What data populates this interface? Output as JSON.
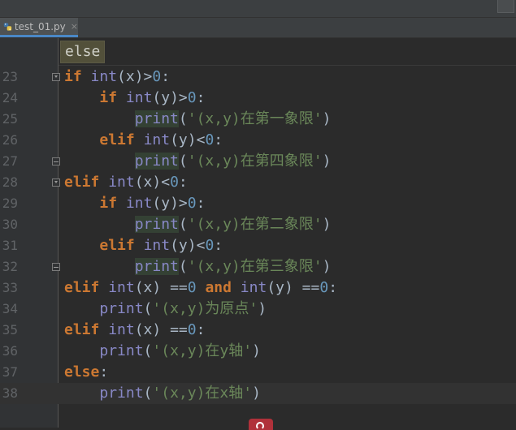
{
  "tab": {
    "filename": "test_01.py",
    "close_glyph": "×"
  },
  "tooltip": {
    "text": "else"
  },
  "lines": [
    {
      "num": "23",
      "tokens": [
        {
          "t": "if",
          "c": "kw"
        },
        {
          "t": " ",
          "c": "pl"
        },
        {
          "t": "int",
          "c": "bi"
        },
        {
          "t": "(x)>",
          "c": "pl"
        },
        {
          "t": "0",
          "c": "num"
        },
        {
          "t": ":",
          "c": "pl"
        }
      ]
    },
    {
      "num": "24",
      "tokens": [
        {
          "t": "    ",
          "c": "pl"
        },
        {
          "t": "if",
          "c": "kw"
        },
        {
          "t": " ",
          "c": "pl"
        },
        {
          "t": "int",
          "c": "bi"
        },
        {
          "t": "(y)>",
          "c": "pl"
        },
        {
          "t": "0",
          "c": "num"
        },
        {
          "t": ":",
          "c": "pl"
        }
      ]
    },
    {
      "num": "25",
      "tokens": [
        {
          "t": "        ",
          "c": "pl"
        },
        {
          "t": "print",
          "c": "bi hl"
        },
        {
          "t": "(",
          "c": "pl"
        },
        {
          "t": "'(x,y)在第一象限'",
          "c": "str"
        },
        {
          "t": ")",
          "c": "pl"
        }
      ]
    },
    {
      "num": "26",
      "tokens": [
        {
          "t": "    ",
          "c": "pl"
        },
        {
          "t": "elif",
          "c": "kw"
        },
        {
          "t": " ",
          "c": "pl"
        },
        {
          "t": "int",
          "c": "bi"
        },
        {
          "t": "(y)<",
          "c": "pl"
        },
        {
          "t": "0",
          "c": "num"
        },
        {
          "t": ":",
          "c": "pl"
        }
      ]
    },
    {
      "num": "27",
      "tokens": [
        {
          "t": "        ",
          "c": "pl"
        },
        {
          "t": "print",
          "c": "bi hl"
        },
        {
          "t": "(",
          "c": "pl"
        },
        {
          "t": "'(x,y)在第四象限'",
          "c": "str"
        },
        {
          "t": ")",
          "c": "pl"
        }
      ]
    },
    {
      "num": "28",
      "tokens": [
        {
          "t": "elif",
          "c": "kw"
        },
        {
          "t": " ",
          "c": "pl"
        },
        {
          "t": "int",
          "c": "bi"
        },
        {
          "t": "(x)<",
          "c": "pl"
        },
        {
          "t": "0",
          "c": "num"
        },
        {
          "t": ":",
          "c": "pl"
        }
      ]
    },
    {
      "num": "29",
      "tokens": [
        {
          "t": "    ",
          "c": "pl"
        },
        {
          "t": "if",
          "c": "kw"
        },
        {
          "t": " ",
          "c": "pl"
        },
        {
          "t": "int",
          "c": "bi"
        },
        {
          "t": "(y)>",
          "c": "pl"
        },
        {
          "t": "0",
          "c": "num"
        },
        {
          "t": ":",
          "c": "pl"
        }
      ]
    },
    {
      "num": "30",
      "tokens": [
        {
          "t": "        ",
          "c": "pl"
        },
        {
          "t": "print",
          "c": "bi hl"
        },
        {
          "t": "(",
          "c": "pl"
        },
        {
          "t": "'(x,y)在第二象限'",
          "c": "str"
        },
        {
          "t": ")",
          "c": "pl"
        }
      ]
    },
    {
      "num": "31",
      "tokens": [
        {
          "t": "    ",
          "c": "pl"
        },
        {
          "t": "elif",
          "c": "kw"
        },
        {
          "t": " ",
          "c": "pl"
        },
        {
          "t": "int",
          "c": "bi"
        },
        {
          "t": "(y)<",
          "c": "pl"
        },
        {
          "t": "0",
          "c": "num"
        },
        {
          "t": ":",
          "c": "pl"
        }
      ]
    },
    {
      "num": "32",
      "tokens": [
        {
          "t": "        ",
          "c": "pl"
        },
        {
          "t": "print",
          "c": "bi hl"
        },
        {
          "t": "(",
          "c": "pl"
        },
        {
          "t": "'(x,y)在第三象限'",
          "c": "str"
        },
        {
          "t": ")",
          "c": "pl"
        }
      ]
    },
    {
      "num": "33",
      "tokens": [
        {
          "t": "elif",
          "c": "kw"
        },
        {
          "t": " ",
          "c": "pl"
        },
        {
          "t": "int",
          "c": "bi"
        },
        {
          "t": "(x) ==",
          "c": "pl"
        },
        {
          "t": "0",
          "c": "num"
        },
        {
          "t": " ",
          "c": "pl"
        },
        {
          "t": "and",
          "c": "kw"
        },
        {
          "t": " ",
          "c": "pl"
        },
        {
          "t": "int",
          "c": "bi"
        },
        {
          "t": "(y) ==",
          "c": "pl"
        },
        {
          "t": "0",
          "c": "num"
        },
        {
          "t": ":",
          "c": "pl"
        }
      ]
    },
    {
      "num": "34",
      "tokens": [
        {
          "t": "    ",
          "c": "pl"
        },
        {
          "t": "print",
          "c": "bi"
        },
        {
          "t": "(",
          "c": "pl"
        },
        {
          "t": "'(x,y)为原点'",
          "c": "str"
        },
        {
          "t": ")",
          "c": "pl"
        }
      ]
    },
    {
      "num": "35",
      "tokens": [
        {
          "t": "elif",
          "c": "kw"
        },
        {
          "t": " ",
          "c": "pl"
        },
        {
          "t": "int",
          "c": "bi"
        },
        {
          "t": "(x) ==",
          "c": "pl"
        },
        {
          "t": "0",
          "c": "num"
        },
        {
          "t": ":",
          "c": "pl"
        }
      ]
    },
    {
      "num": "36",
      "tokens": [
        {
          "t": "    ",
          "c": "pl"
        },
        {
          "t": "print",
          "c": "bi"
        },
        {
          "t": "(",
          "c": "pl"
        },
        {
          "t": "'(x,y)在y轴'",
          "c": "str"
        },
        {
          "t": ")",
          "c": "pl"
        }
      ]
    },
    {
      "num": "37",
      "tokens": [
        {
          "t": "else",
          "c": "kw"
        },
        {
          "t": ":",
          "c": "pl"
        }
      ]
    },
    {
      "num": "38",
      "tokens": [
        {
          "t": "    ",
          "c": "pl"
        },
        {
          "t": "print",
          "c": "bi"
        },
        {
          "t": "(",
          "c": "pl"
        },
        {
          "t": "'(x,y)在x轴'",
          "c": "str"
        },
        {
          "t": ")",
          "c": "pl"
        }
      ]
    }
  ],
  "caret_line": "38",
  "fold_open_lines": [
    "23",
    "28"
  ],
  "fold_end_lines": [
    "27",
    "32"
  ],
  "colors": {
    "background": "#2b2b2b",
    "keyword": "#cc7832",
    "builtin": "#8888c6",
    "number": "#6897bb",
    "string": "#6a8759",
    "plain": "#a9b7c6"
  }
}
